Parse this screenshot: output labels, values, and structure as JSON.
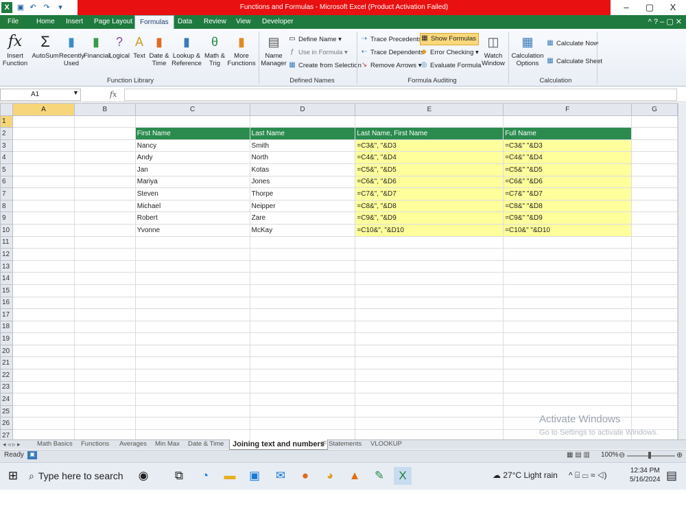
{
  "window": {
    "title": "Functions and Formulas - Microsoft Excel (Product Activation Failed)",
    "minimize": "–",
    "restore": "▢",
    "close": "X"
  },
  "ribbon_tabs": [
    "File",
    "Home",
    "Insert",
    "Page Layout",
    "Formulas",
    "Data",
    "Review",
    "View",
    "Developer"
  ],
  "ribbon": {
    "insert_function": "Insert\nFunction",
    "autosum": "AutoSum",
    "recently_used": "Recently\nUsed",
    "financial": "Financial",
    "logical": "Logical",
    "text": "Text",
    "date_time": "Date &\nTime",
    "lookup_reference": "Lookup &\nReference",
    "math_trig": "Math &\nTrig",
    "more_functions": "More\nFunctions",
    "function_library_label": "Function Library",
    "name_manager": "Name\nManager",
    "define_name": "Define Name",
    "use_in_formula": "Use in Formula",
    "create_from_selection": "Create from Selection",
    "defined_names_label": "Defined Names",
    "trace_precedents": "Trace Precedents",
    "trace_dependents": "Trace Dependents",
    "remove_arrows": "Remove Arrows",
    "show_formulas": "Show Formulas",
    "error_checking": "Error Checking",
    "evaluate_formula": "Evaluate Formula",
    "formula_auditing_label": "Formula Auditing",
    "watch_window": "Watch\nWindow",
    "calculation_options": "Calculation\nOptions",
    "calculate_now": "Calculate Now",
    "calculate_sheet": "Calculate Sheet",
    "calculation_label": "Calculation"
  },
  "formula_bar": {
    "name_box": "A1",
    "fx": "fx",
    "value": ""
  },
  "columns": [
    "A",
    "B",
    "C",
    "D",
    "E",
    "F",
    "G"
  ],
  "rows": [
    {
      "n": "1",
      "c": [
        "",
        "",
        "",
        "",
        ""
      ]
    },
    {
      "n": "2",
      "c": [
        "First Name",
        "Last Name",
        "Last Name, First Name",
        "Full Name"
      ]
    },
    {
      "n": "3",
      "c": [
        "Nancy",
        "Smith",
        "=C3&\", \"&D3",
        "=C3&\" \"&D3"
      ]
    },
    {
      "n": "4",
      "c": [
        "Andy",
        "North",
        "=C4&\", \"&D4",
        "=C4&\" \"&D4"
      ]
    },
    {
      "n": "5",
      "c": [
        "Jan",
        "Kotas",
        "=C5&\", \"&D5",
        "=C5&\" \"&D5"
      ]
    },
    {
      "n": "6",
      "c": [
        "Mariya",
        "Jones",
        "=C6&\", \"&D6",
        "=C6&\" \"&D6"
      ]
    },
    {
      "n": "7",
      "c": [
        "Steven",
        "Thorpe",
        "=C7&\", \"&D7",
        "=C7&\" \"&D7"
      ]
    },
    {
      "n": "8",
      "c": [
        "Michael",
        "Neipper",
        "=C8&\", \"&D8",
        "=C8&\" \"&D8"
      ]
    },
    {
      "n": "9",
      "c": [
        "Robert",
        "Zare",
        "=C9&\", \"&D9",
        "=C9&\" \"&D9"
      ]
    },
    {
      "n": "10",
      "c": [
        "Yvonne",
        "McKay",
        "=C10&\", \"&D10",
        "=C10&\" \"&D10"
      ]
    }
  ],
  "empty_rows": [
    "11",
    "12",
    "13",
    "14",
    "15",
    "16",
    "17",
    "18",
    "19",
    "20",
    "21",
    "22",
    "23",
    "24",
    "25",
    "26",
    "27"
  ],
  "sheet_tabs": [
    "Math Basics",
    "Functions",
    "Averages",
    "Min Max",
    "Date & Time",
    "Joining text and numbers",
    "IF Statements",
    "VLOOKUP"
  ],
  "active_sheet": "Joining text and numbers",
  "status": {
    "mode": "Ready",
    "zoom": "100%"
  },
  "watermark": {
    "line1": "Activate Windows",
    "line2": "Go to Settings to activate Windows."
  },
  "taskbar": {
    "search_placeholder": "Type here to search",
    "weather": "27°C  Light rain",
    "time": "12:34 PM",
    "date": "5/16/2024"
  },
  "colors": {
    "excel_green": "#1f7a3f",
    "header_green": "#2b8b4e",
    "formula_yellow": "#ffff9c",
    "title_red": "#e81010"
  }
}
